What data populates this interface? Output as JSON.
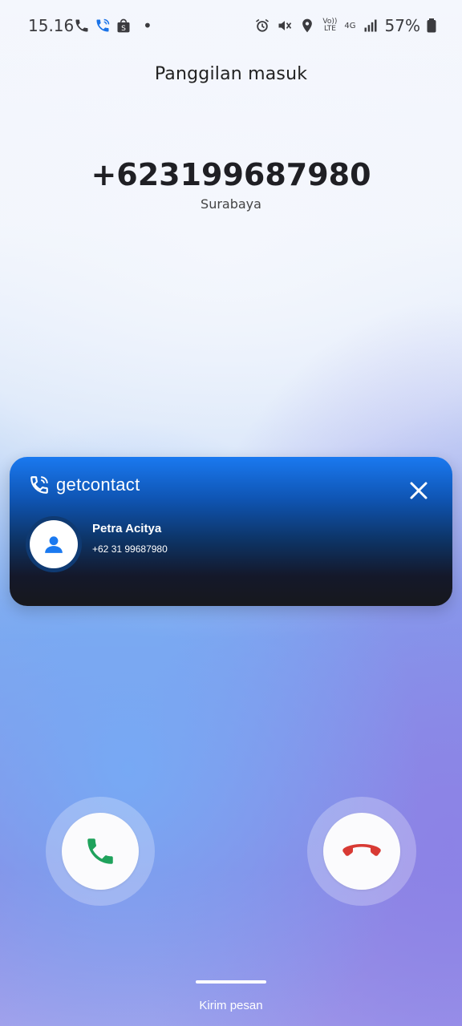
{
  "status_bar": {
    "time": "15.16",
    "battery": "57%",
    "left_icons": [
      "phone-icon",
      "wifi-call-icon",
      "shopee-icon",
      "dot-icon"
    ],
    "right_icons": [
      "alarm-icon",
      "mute-icon",
      "location-icon",
      "volte-icon",
      "4g-icon",
      "signal-icon",
      "battery-icon"
    ],
    "network_volte": "Vo)) LTE",
    "network_type": "4G"
  },
  "call": {
    "title": "Panggilan masuk",
    "number": "+623199687980",
    "location": "Surabaya"
  },
  "getcontact": {
    "brand": "getcontact",
    "name": "Petra Acitya",
    "phone": "+62 31 99687980",
    "accent": "#1a79f0"
  },
  "actions": {
    "accept_icon": "phone-accept-icon",
    "decline_icon": "phone-decline-icon",
    "accept_color": "#1fa25c",
    "decline_color": "#d83a34"
  },
  "footer": {
    "message_label": "Kirim pesan"
  }
}
